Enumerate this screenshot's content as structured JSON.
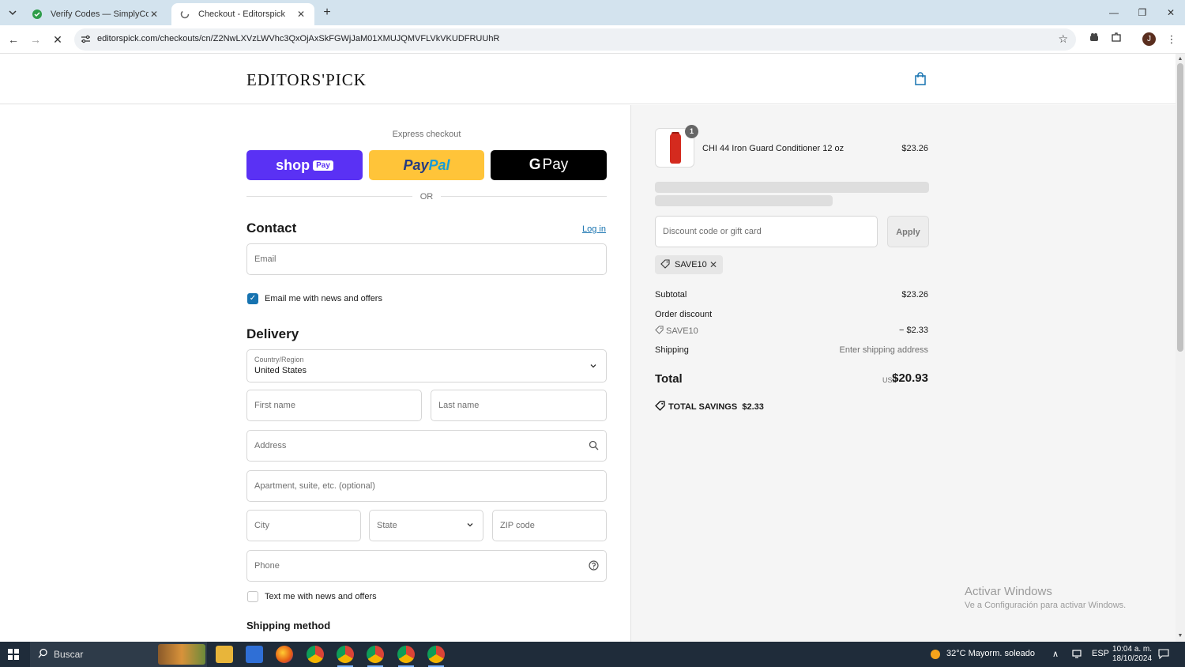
{
  "browser": {
    "tabs": [
      {
        "title": "Verify Codes — SimplyCodes",
        "active": false
      },
      {
        "title": "Checkout - Editorspick",
        "active": true
      }
    ],
    "url": "editorspick.com/checkouts/cn/Z2NwLXVzLWVhc3QxOjAxSkFGWjJaM01XMUJQMVFLVkVKUDFRUUhR",
    "profile_initial": "J"
  },
  "header": {
    "logo": "EDITORS'PICK"
  },
  "express": {
    "label": "Express checkout",
    "shoppay": "shop",
    "shoppay_badge": "Pay",
    "paypal_a": "Pay",
    "paypal_b": "Pal",
    "gpay_g": "G",
    "gpay": "Pay",
    "or": "OR"
  },
  "contact": {
    "title": "Contact",
    "login": "Log in",
    "email_placeholder": "Email",
    "news_label": "Email me with news and offers",
    "news_checked": true
  },
  "delivery": {
    "title": "Delivery",
    "country_label": "Country/Region",
    "country_value": "United States",
    "first_name": "First name",
    "last_name": "Last name",
    "address": "Address",
    "apartment": "Apartment, suite, etc. (optional)",
    "city": "City",
    "state": "State",
    "zip": "ZIP code",
    "phone": "Phone",
    "sms_label": "Text me with news and offers",
    "sms_checked": false
  },
  "shipping_method": {
    "title": "Shipping method"
  },
  "summary": {
    "item": {
      "name": "CHI 44 Iron Guard Conditioner 12 oz",
      "price": "$23.26",
      "quantity": "1"
    },
    "discount_placeholder": "Discount code or gift card",
    "apply_label": "Apply",
    "applied_code": "SAVE10",
    "subtotal_label": "Subtotal",
    "subtotal": "$23.26",
    "order_discount_label": "Order discount",
    "discount_code": "SAVE10",
    "discount_value": "− $2.33",
    "shipping_label": "Shipping",
    "shipping_value": "Enter shipping address",
    "total_label": "Total",
    "currency": "USD",
    "total": "$20.93",
    "savings_label": "TOTAL SAVINGS",
    "savings_value": "$2.33"
  },
  "watermark": {
    "line1": "Activar Windows",
    "line2": "Ve a Configuración para activar Windows."
  },
  "taskbar": {
    "search": "Buscar",
    "weather": "32°C  Mayorm. soleado",
    "language": "ESP",
    "time": "10:04 a. m.",
    "date": "18/10/2024"
  },
  "colors": {
    "accent": "#1773b0",
    "shoppay": "#5a31f4",
    "paypal": "#ffc439",
    "summary_bg": "#f5f5f5"
  }
}
